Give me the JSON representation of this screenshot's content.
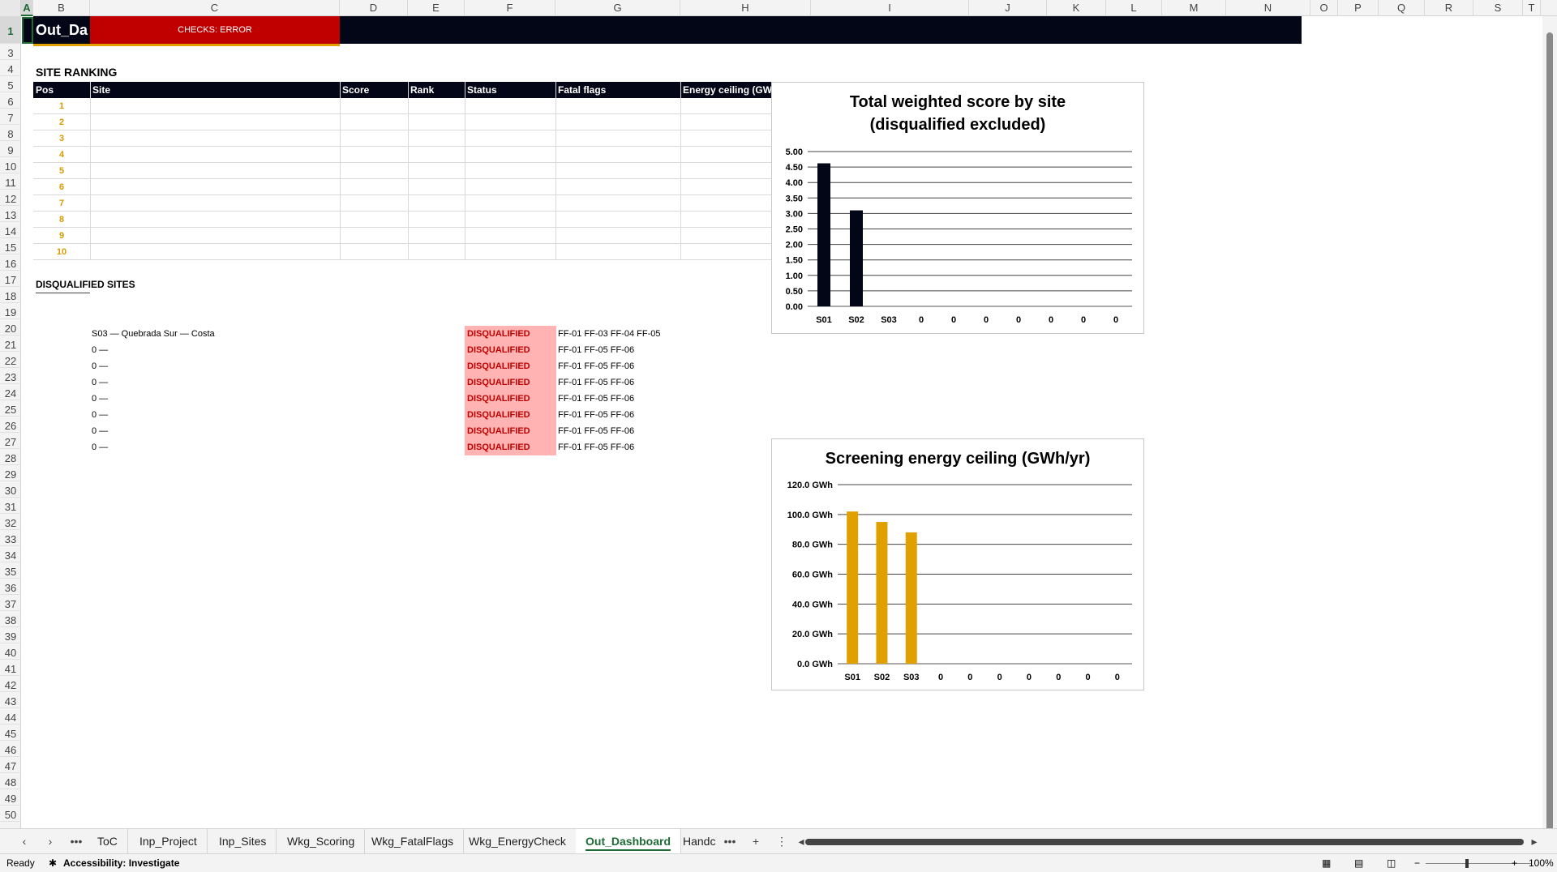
{
  "columns": [
    "A",
    "B",
    "C",
    "D",
    "E",
    "F",
    "G",
    "H",
    "I",
    "J",
    "K",
    "L",
    "M",
    "N",
    "O",
    "P",
    "Q",
    "R",
    "S",
    "T"
  ],
  "rows": [
    "1",
    "3",
    "4",
    "5",
    "6",
    "7",
    "8",
    "9",
    "10",
    "11",
    "12",
    "13",
    "14",
    "15",
    "16",
    "17",
    "18",
    "19",
    "20",
    "21",
    "22",
    "23",
    "24",
    "25",
    "26",
    "27",
    "28",
    "29",
    "30",
    "31",
    "32",
    "33",
    "34",
    "35",
    "36",
    "37",
    "38",
    "39",
    "40",
    "41",
    "42",
    "43",
    "44",
    "45",
    "46",
    "47",
    "48",
    "49",
    "50"
  ],
  "banner": {
    "title": "Out_Da",
    "checks": "CHECKS: ERROR"
  },
  "ranking": {
    "title": "SITE RANKING",
    "headers": [
      "Pos",
      "Site",
      "Score",
      "Rank",
      "Status",
      "Fatal flags",
      "Energy ceiling (GW"
    ],
    "positions": [
      "1",
      "2",
      "3",
      "4",
      "5",
      "6",
      "7",
      "8",
      "9",
      "10"
    ]
  },
  "disqualified": {
    "title": "DISQUALIFIED SITES",
    "items": [
      {
        "site": "S03  —  Quebrada Sur — Costa",
        "status": "DISQUALIFIED",
        "flags": "FF-01 FF-03 FF-04 FF-05"
      },
      {
        "site": "0  —",
        "status": "DISQUALIFIED",
        "flags": "FF-01 FF-05 FF-06"
      },
      {
        "site": "0  —",
        "status": "DISQUALIFIED",
        "flags": "FF-01 FF-05 FF-06"
      },
      {
        "site": "0  —",
        "status": "DISQUALIFIED",
        "flags": "FF-01 FF-05 FF-06"
      },
      {
        "site": "0  —",
        "status": "DISQUALIFIED",
        "flags": "FF-01 FF-05 FF-06"
      },
      {
        "site": "0  —",
        "status": "DISQUALIFIED",
        "flags": "FF-01 FF-05 FF-06"
      },
      {
        "site": "0  —",
        "status": "DISQUALIFIED",
        "flags": "FF-01 FF-05 FF-06"
      },
      {
        "site": "0  —",
        "status": "DISQUALIFIED",
        "flags": "FF-01 FF-05 FF-06"
      }
    ]
  },
  "chart_data": [
    {
      "type": "bar",
      "title_line1": "Total weighted score by site",
      "title_line2": "(disqualified excluded)",
      "categories": [
        "S01",
        "S02",
        "S03",
        "0",
        "0",
        "0",
        "0",
        "0",
        "0",
        "0"
      ],
      "values": [
        4.62,
        3.1,
        0,
        0,
        0,
        0,
        0,
        0,
        0,
        0
      ],
      "ylim": [
        0,
        5
      ],
      "yticks": [
        "0.00",
        "0.50",
        "1.00",
        "1.50",
        "2.00",
        "2.50",
        "3.00",
        "3.50",
        "4.00",
        "4.50",
        "5.00"
      ],
      "grid": true,
      "color": "#020617"
    },
    {
      "type": "bar",
      "title": "Screening energy ceiling (GWh/yr)",
      "categories": [
        "S01",
        "S02",
        "S03",
        "0",
        "0",
        "0",
        "0",
        "0",
        "0",
        "0"
      ],
      "values": [
        102,
        95,
        88,
        0,
        0,
        0,
        0,
        0,
        0,
        0
      ],
      "ylim": [
        0,
        120
      ],
      "yticks": [
        "0.0 GWh",
        "20.0 GWh",
        "40.0 GWh",
        "60.0 GWh",
        "80.0 GWh",
        "100.0 GWh",
        "120.0 GWh"
      ],
      "grid": true,
      "color": "#e0a000"
    }
  ],
  "tabs": {
    "more": "•••",
    "add": "+",
    "menu": "⋮",
    "items": [
      "ToC",
      "Inp_Project",
      "Inp_Sites",
      "Wkg_Scoring",
      "Wkg_FatalFlags",
      "Wkg_EnergyCheck",
      "Out_Dashboard",
      "Handc"
    ],
    "active": "Out_Dashboard"
  },
  "status": {
    "ready": "Ready",
    "accessibility": "Accessibility: Investigate",
    "zoom": "100%",
    "zoom_minus": "−",
    "zoom_plus": "+"
  },
  "icons": {
    "accessibility": "accessibility-icon",
    "normal_view": "normal-view-icon",
    "page_layout": "page-layout-icon",
    "page_break": "page-break-icon"
  }
}
